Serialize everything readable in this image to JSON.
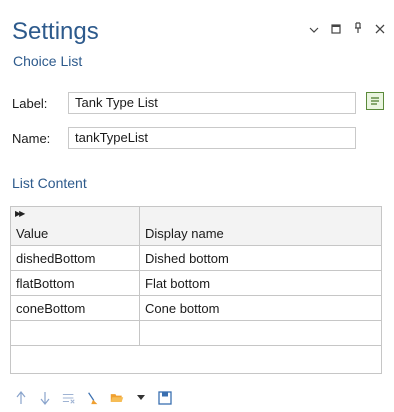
{
  "header": {
    "title": "Settings",
    "subtitle": "Choice List"
  },
  "form": {
    "label_caption": "Label:",
    "label_value": "Tank Type List",
    "name_caption": "Name:",
    "name_value": "tankTypeList"
  },
  "list_content": {
    "title": "List Content",
    "columns": [
      "Value",
      "Display name"
    ],
    "rows": [
      [
        "dishedBottom",
        "Dished bottom"
      ],
      [
        "flatBottom",
        "Flat bottom"
      ],
      [
        "coneBottom",
        "Cone bottom"
      ],
      [
        "",
        ""
      ]
    ]
  },
  "icons": {
    "window": [
      "chevron-down-icon",
      "maximize-icon",
      "pin-icon",
      "close-icon"
    ],
    "toolbar": [
      "move-up-icon",
      "move-down-icon",
      "clear-table-icon",
      "sweep-icon",
      "open-folder-icon",
      "dropdown-icon",
      "save-icon"
    ]
  },
  "colors": {
    "accent": "#2d5a8c",
    "toolbar_blue": "#6f93c8",
    "folder": "#f0a030"
  }
}
